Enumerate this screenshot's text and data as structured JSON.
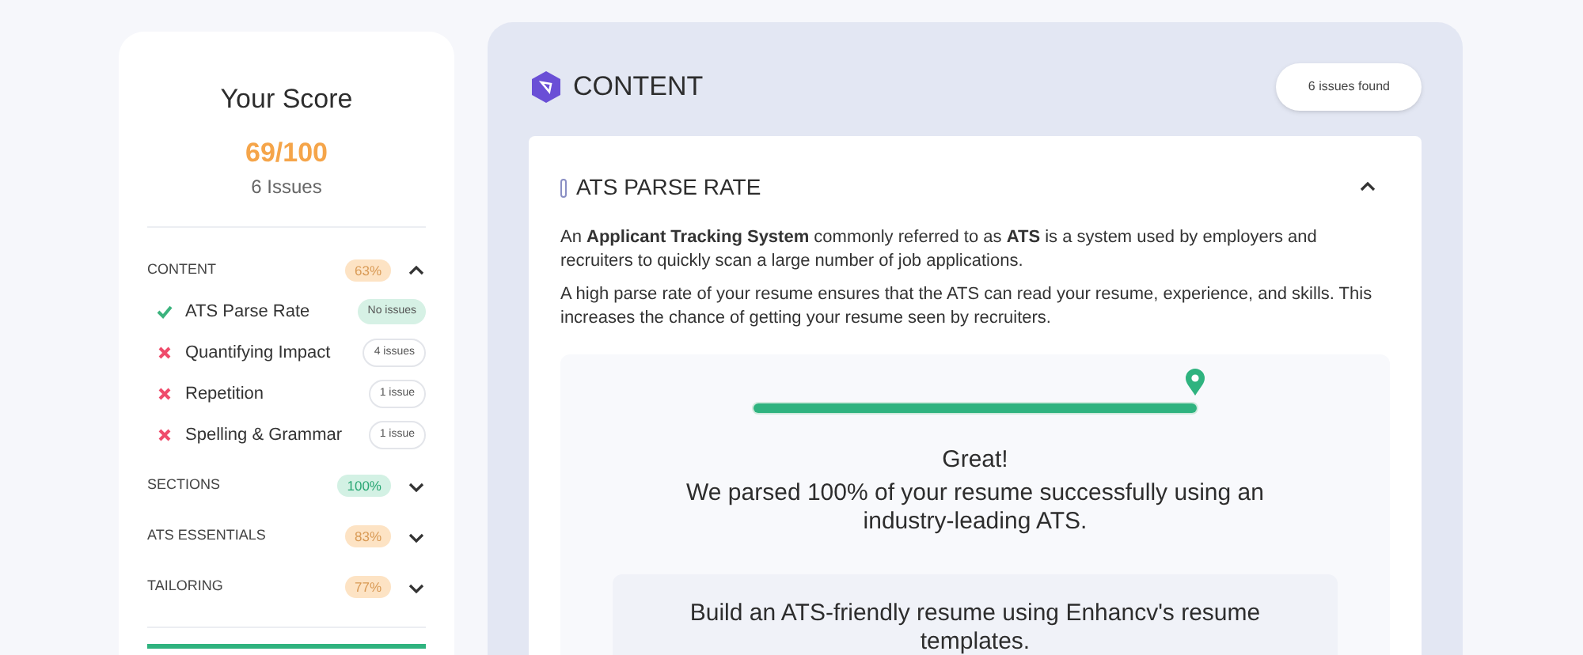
{
  "score": {
    "title": "Your Score",
    "value": "69/100",
    "issues": "6 Issues"
  },
  "groups": [
    {
      "label": "CONTENT",
      "percent": "63%",
      "color": "#fde3c4",
      "expanded": true,
      "items": [
        {
          "label": "ATS Parse Rate",
          "passed": true,
          "badge": "No issues"
        },
        {
          "label": "Quantifying Impact",
          "passed": false,
          "badge": "4 issues"
        },
        {
          "label": "Repetition",
          "passed": false,
          "badge": "1 issue"
        },
        {
          "label": "Spelling & Grammar",
          "passed": false,
          "badge": "1 issue"
        }
      ]
    },
    {
      "label": "SECTIONS",
      "percent": "100%",
      "color": "#d3f1e4",
      "expanded": false
    },
    {
      "label": "ATS ESSENTIALS",
      "percent": "83%",
      "color": "#fde3c4",
      "expanded": false
    },
    {
      "label": "TAILORING",
      "percent": "77%",
      "color": "#fde3c4",
      "expanded": false
    }
  ],
  "panel": {
    "title": "CONTENT",
    "issues_found": "6 issues found",
    "section": {
      "title": "ATS PARSE RATE",
      "expanded": true,
      "paragraphs": [
        "An **Applicant Tracking System** commonly referred to as **ATS** is a system used by employers and recruiters to quickly scan a large number of job applications.",
        "A high parse rate of your resume ensures that the ATS can read your resume, experience, and skills. This increases the chance of getting your resume seen by recruiters."
      ],
      "parse": {
        "level": 1,
        "headline": "Great!",
        "message": "We parsed 100% of your resume successfully using an industry-leading ATS."
      },
      "tip": "Build an ATS-friendly resume using Enhancv's resume templates."
    }
  }
}
